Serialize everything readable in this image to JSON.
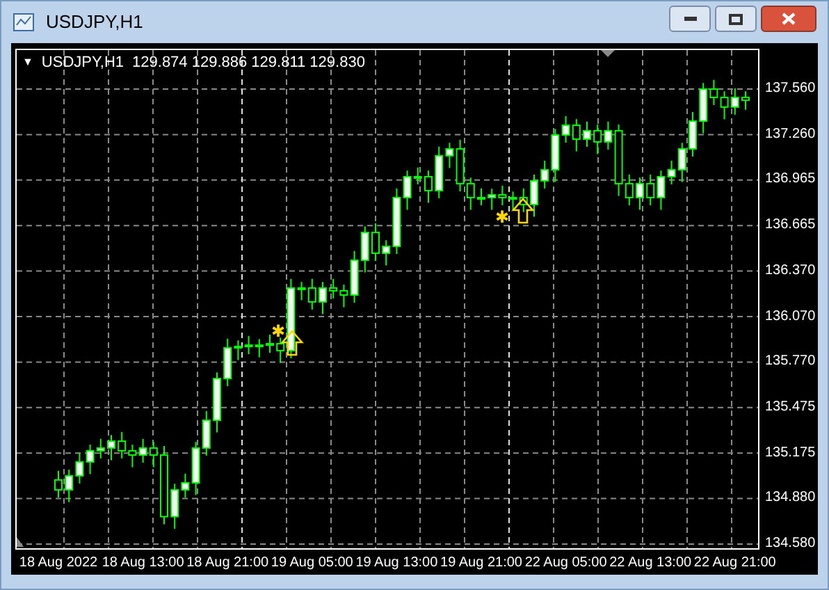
{
  "window": {
    "title": "USDJPY,H1"
  },
  "chart": {
    "dropdown": "▼",
    "symbol": "USDJPY,H1",
    "quote": "129.874 129.886 129.811 129.830",
    "signals": [
      {
        "glyph": "✱"
      },
      {
        "glyph": "✱"
      }
    ],
    "chart_data": {
      "type": "candlestick",
      "grid": true,
      "ylim": [
        134.58,
        137.56
      ],
      "yticks": [
        {
          "value": 137.56,
          "label": "137.560"
        },
        {
          "value": 137.26,
          "label": "137.260"
        },
        {
          "value": 136.965,
          "label": "136.965"
        },
        {
          "value": 136.665,
          "label": "136.665"
        },
        {
          "value": 136.37,
          "label": "136.370"
        },
        {
          "value": 136.07,
          "label": "136.070"
        },
        {
          "value": 135.77,
          "label": "135.770"
        },
        {
          "value": 135.475,
          "label": "135.475"
        },
        {
          "value": 135.175,
          "label": "135.175"
        },
        {
          "value": 134.88,
          "label": "134.880"
        },
        {
          "value": 134.58,
          "label": "134.580"
        }
      ],
      "categories": [
        "18 Aug 2022",
        null,
        null,
        null,
        null,
        null,
        null,
        null,
        "18 Aug 13:00",
        null,
        null,
        null,
        null,
        null,
        null,
        null,
        "18 Aug 21:00",
        null,
        null,
        null,
        null,
        null,
        null,
        null,
        "19 Aug 05:00",
        null,
        null,
        null,
        null,
        null,
        null,
        null,
        "19 Aug 13:00",
        null,
        null,
        null,
        null,
        null,
        null,
        null,
        "19 Aug 21:00",
        null,
        null,
        null,
        null,
        null,
        null,
        null,
        "22 Aug 05:00",
        null,
        null,
        null,
        null,
        null,
        null,
        null,
        "22 Aug 13:00",
        null,
        null,
        null,
        null,
        null,
        null,
        null,
        "22 Aug 21:00",
        null
      ],
      "ohlc": [
        [
          135.0,
          135.06,
          134.885,
          134.935
        ],
        [
          134.935,
          135.067,
          134.855,
          135.027
        ],
        [
          135.027,
          135.178,
          134.977,
          135.118
        ],
        [
          135.118,
          135.231,
          135.038,
          135.191
        ],
        [
          135.191,
          135.269,
          135.141,
          135.209
        ],
        [
          135.209,
          135.294,
          135.129,
          135.254
        ],
        [
          135.254,
          135.314,
          135.141,
          135.191
        ],
        [
          135.191,
          135.231,
          135.083,
          135.163
        ],
        [
          135.163,
          135.269,
          135.113,
          135.209
        ],
        [
          135.209,
          135.249,
          135.083,
          135.163
        ],
        [
          135.163,
          135.223,
          134.71,
          134.76
        ],
        [
          134.76,
          134.975,
          134.68,
          134.935
        ],
        [
          134.935,
          135.041,
          134.885,
          134.981
        ],
        [
          134.981,
          135.249,
          134.901,
          135.209
        ],
        [
          135.209,
          135.451,
          135.159,
          135.391
        ],
        [
          135.391,
          135.704,
          135.311,
          135.664
        ],
        [
          135.664,
          135.925,
          135.614,
          135.865
        ],
        [
          135.865,
          135.914,
          135.785,
          135.874
        ],
        [
          135.874,
          135.943,
          135.824,
          135.883
        ],
        [
          135.883,
          135.923,
          135.803,
          135.883
        ],
        [
          135.883,
          135.952,
          135.833,
          135.892
        ],
        [
          135.892,
          135.932,
          135.767,
          135.847
        ],
        [
          135.847,
          136.317,
          135.797,
          136.257
        ],
        [
          136.257,
          136.297,
          136.177,
          136.257
        ],
        [
          136.257,
          136.317,
          136.116,
          136.166
        ],
        [
          136.166,
          136.297,
          136.086,
          136.257
        ],
        [
          136.257,
          136.317,
          136.189,
          136.239
        ],
        [
          136.239,
          136.279,
          136.131,
          136.211
        ],
        [
          136.211,
          136.499,
          136.161,
          136.439
        ],
        [
          136.439,
          136.661,
          136.359,
          136.621
        ],
        [
          136.621,
          136.681,
          136.435,
          136.485
        ],
        [
          136.485,
          136.57,
          136.405,
          136.53
        ],
        [
          136.53,
          136.909,
          136.48,
          136.849
        ],
        [
          136.849,
          137.026,
          136.769,
          136.986
        ],
        [
          136.986,
          137.046,
          136.936,
          136.986
        ],
        [
          136.986,
          137.026,
          136.815,
          136.895
        ],
        [
          136.895,
          137.183,
          136.845,
          137.123
        ],
        [
          137.123,
          137.208,
          137.043,
          137.168
        ],
        [
          137.168,
          137.228,
          136.89,
          136.94
        ],
        [
          136.94,
          136.98,
          136.769,
          136.849
        ],
        [
          136.849,
          136.909,
          136.799,
          136.849
        ],
        [
          136.849,
          136.907,
          136.769,
          136.867
        ],
        [
          136.867,
          136.927,
          136.799,
          136.849
        ],
        [
          136.849,
          136.889,
          136.769,
          136.849
        ],
        [
          136.849,
          136.909,
          136.754,
          136.804
        ],
        [
          136.804,
          136.999,
          136.724,
          136.959
        ],
        [
          136.959,
          137.091,
          136.909,
          137.031
        ],
        [
          137.031,
          137.299,
          136.951,
          137.259
        ],
        [
          137.259,
          137.383,
          137.209,
          137.323
        ],
        [
          137.323,
          137.363,
          137.152,
          137.232
        ],
        [
          137.232,
          137.347,
          137.182,
          137.287
        ],
        [
          137.287,
          137.327,
          137.134,
          137.214
        ],
        [
          137.214,
          137.347,
          137.164,
          137.287
        ],
        [
          137.287,
          137.327,
          136.86,
          136.94
        ],
        [
          136.94,
          137.0,
          136.799,
          136.849
        ],
        [
          136.849,
          136.98,
          136.769,
          136.94
        ],
        [
          136.94,
          137.0,
          136.799,
          136.849
        ],
        [
          136.849,
          137.026,
          136.769,
          136.986
        ],
        [
          136.986,
          137.091,
          136.936,
          137.031
        ],
        [
          137.031,
          137.208,
          136.951,
          137.168
        ],
        [
          137.168,
          137.41,
          137.118,
          137.35
        ],
        [
          137.35,
          137.6,
          137.27,
          137.56
        ],
        [
          137.56,
          137.62,
          137.455,
          137.505
        ],
        [
          137.505,
          137.545,
          137.362,
          137.442
        ],
        [
          137.442,
          137.565,
          137.392,
          137.505
        ],
        [
          137.505,
          137.545,
          137.425,
          137.487
        ]
      ]
    }
  }
}
